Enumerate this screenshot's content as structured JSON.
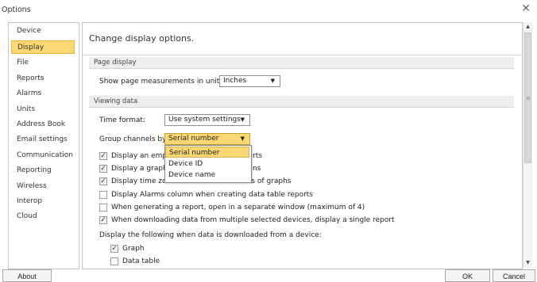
{
  "window": {
    "title": "Options",
    "close_glyph": "✕"
  },
  "sidebar": {
    "items": [
      {
        "label": "Device"
      },
      {
        "label": "Display"
      },
      {
        "label": "File"
      },
      {
        "label": "Reports"
      },
      {
        "label": "Alarms"
      },
      {
        "label": "Units"
      },
      {
        "label": "Address Book"
      },
      {
        "label": "Email settings"
      },
      {
        "label": "Communication"
      },
      {
        "label": "Reporting"
      },
      {
        "label": "Wireless"
      },
      {
        "label": "Interop"
      },
      {
        "label": "Cloud"
      }
    ],
    "selected": "Display"
  },
  "main": {
    "header": "Change display options.",
    "page_display": {
      "section": "Page display",
      "units_label": "Show page measurements in units of:",
      "units_value": "Inches"
    },
    "viewing_data": {
      "section": "Viewing data",
      "time_format_label": "Time format:",
      "time_format_value": "Use system settings",
      "group_label": "Group channels by:",
      "group_value": "Serial number",
      "group_options": [
        "Serial number",
        "Device ID",
        "Device name"
      ]
    },
    "checkboxes": [
      {
        "label_left": "Display an empty",
        "label_right": "rts",
        "checked": true
      },
      {
        "label_left": "Display a graph w",
        "label_right": "ns",
        "checked": true
      },
      {
        "label": "Display time zone on the horizontal axis of graphs",
        "checked": true
      },
      {
        "label": "Display Alarms column when creating data table reports",
        "checked": false
      },
      {
        "label": "When generating a report, open in a separate window (maximum of 4)",
        "checked": false
      },
      {
        "label": "When downloading data from multiple selected devices, display a single report",
        "checked": true
      }
    ],
    "download_label": "Display the following when data is downloaded from a device:",
    "download_options": [
      {
        "label": "Graph",
        "checked": true
      },
      {
        "label": "Data table",
        "checked": false
      }
    ]
  },
  "buttons": {
    "about": "About",
    "ok": "OK",
    "cancel": "Cancel"
  },
  "glyphs": {
    "dropdown_arrow": "▼",
    "check": "✓",
    "scroll_up": "▲",
    "scroll_down": "▼",
    "grip": "≡"
  },
  "colors": {
    "selection": "#fbd873",
    "selection_border": "#e6b93e"
  }
}
